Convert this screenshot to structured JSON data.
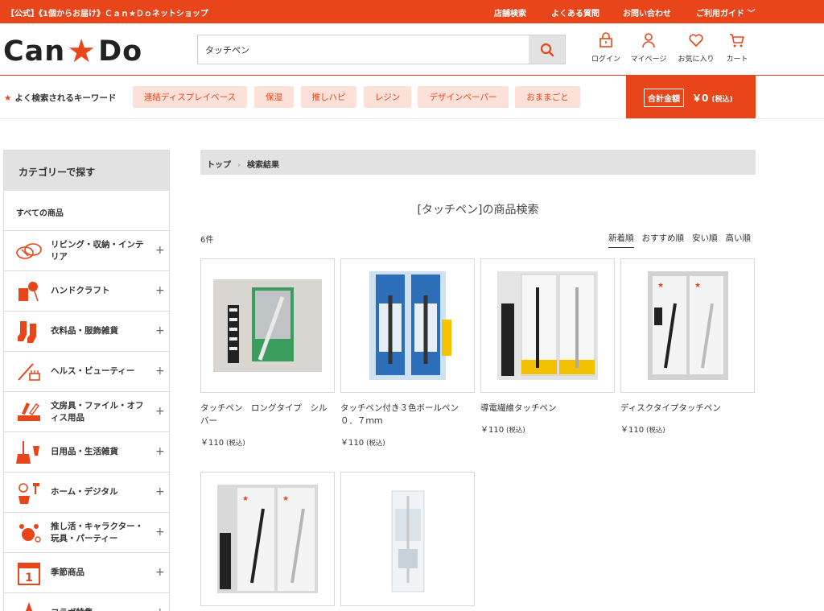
{
  "topbar": {
    "brandline": "【公式】《1個からお届け》Ｃａｎ★Ｄｏネットショップ",
    "nav": [
      "店舗検索",
      "よくある質問",
      "お問い合わせ",
      "ご利用ガイド ﹀"
    ]
  },
  "header": {
    "logo_left": "Can",
    "logo_star": "★",
    "logo_right": "Do",
    "search_value": "タッチペン",
    "icons": {
      "login": "ログイン",
      "mypage": "マイページ",
      "favorites": "お気に入り",
      "cart": "カート"
    }
  },
  "keywords": {
    "label": "よく検索されるキーワード",
    "items": [
      "連結ディスプレイベース",
      "保湿",
      "推しハピ",
      "レジン",
      "デザインペーパー",
      "おままごと"
    ]
  },
  "cart_total": {
    "label": "合計金額",
    "value": "￥0",
    "tax": "(税込)"
  },
  "sidebar": {
    "title": "カテゴリーで探す",
    "all": "すべての商品",
    "items": [
      {
        "label": "リビング・収納・インテリア",
        "icon": "living-icon"
      },
      {
        "label": "ハンドクラフト",
        "icon": "handcraft-icon"
      },
      {
        "label": "衣料品・服飾雑貨",
        "icon": "clothing-icon"
      },
      {
        "label": "ヘルス・ビューティー",
        "icon": "beauty-icon"
      },
      {
        "label": "文房具・ファイル・オフィス用品",
        "icon": "stationery-icon"
      },
      {
        "label": "日用品・生活雑貨",
        "icon": "daily-goods-icon"
      },
      {
        "label": "ホーム・デジタル",
        "icon": "home-digital-icon"
      },
      {
        "label": "推し活・キャラクター・玩具・パーティー",
        "icon": "party-icon"
      },
      {
        "label": "季節商品",
        "icon": "calendar-icon"
      },
      {
        "label": "コラボ特集",
        "icon": "star-icon"
      }
    ],
    "plus": "+"
  },
  "breadcrumb": {
    "home": "トップ",
    "sep": "›",
    "current": "検索結果"
  },
  "results": {
    "title": "[タッチペン]の商品検索",
    "count": "6件",
    "sorts": [
      "新着順",
      "おすすめ順",
      "安い順",
      "高い順"
    ],
    "products": [
      {
        "name": "タッチペン　ロングタイプ　シルバー",
        "price": "￥110",
        "tax": "(税込)"
      },
      {
        "name": "タッチペン付き３色ボールペン　０．７ｍｍ",
        "price": "￥110",
        "tax": "(税込)"
      },
      {
        "name": "導電繊維タッチペン",
        "price": "￥110",
        "tax": "(税込)"
      },
      {
        "name": "ディスクタイプタッチペン",
        "price": "￥110",
        "tax": "(税込)"
      },
      {
        "name": "",
        "price": "",
        "tax": ""
      },
      {
        "name": "",
        "price": "",
        "tax": ""
      }
    ]
  },
  "colors": {
    "brand": "#e8461a",
    "keyword_bg": "#fde0d7",
    "panel_gray": "#e2e2e2"
  }
}
